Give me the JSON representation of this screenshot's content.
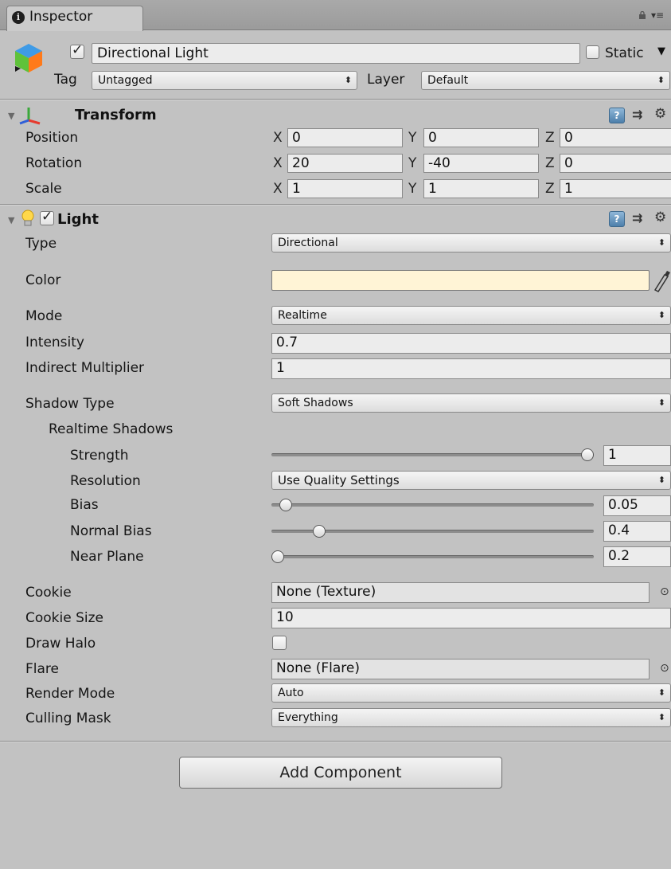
{
  "window": {
    "tab_title": "Inspector"
  },
  "header": {
    "object_name": "Directional Light",
    "active": true,
    "static_label": "Static",
    "static_checked": false,
    "tag_label": "Tag",
    "tag_value": "Untagged",
    "layer_label": "Layer",
    "layer_value": "Default"
  },
  "transform": {
    "title": "Transform",
    "position": {
      "label": "Position",
      "x": "0",
      "y": "0",
      "z": "0"
    },
    "rotation": {
      "label": "Rotation",
      "x": "20",
      "y": "-40",
      "z": "0"
    },
    "scale": {
      "label": "Scale",
      "x": "1",
      "y": "1",
      "z": "1"
    },
    "axes": {
      "x": "X",
      "y": "Y",
      "z": "Z"
    }
  },
  "light": {
    "title": "Light",
    "enabled": true,
    "type": {
      "label": "Type",
      "value": "Directional"
    },
    "color": {
      "label": "Color",
      "value": "#fff4d6"
    },
    "mode": {
      "label": "Mode",
      "value": "Realtime"
    },
    "intensity": {
      "label": "Intensity",
      "value": "0.7"
    },
    "indirect_multiplier": {
      "label": "Indirect Multiplier",
      "value": "1"
    },
    "shadow_type": {
      "label": "Shadow Type",
      "value": "Soft Shadows"
    },
    "realtime_shadows": {
      "label": "Realtime Shadows"
    },
    "strength": {
      "label": "Strength",
      "value": "1",
      "slider_fraction": 1.0
    },
    "resolution": {
      "label": "Resolution",
      "value": "Use Quality Settings"
    },
    "bias": {
      "label": "Bias",
      "value": "0.05",
      "slider_fraction": 0.025
    },
    "normal_bias": {
      "label": "Normal Bias",
      "value": "0.4",
      "slider_fraction": 0.133
    },
    "near_plane": {
      "label": "Near Plane",
      "value": "0.2",
      "slider_fraction": 0.0
    },
    "cookie": {
      "label": "Cookie",
      "value": "None (Texture)"
    },
    "cookie_size": {
      "label": "Cookie Size",
      "value": "10"
    },
    "draw_halo": {
      "label": "Draw Halo",
      "checked": false
    },
    "flare": {
      "label": "Flare",
      "value": "None (Flare)"
    },
    "render_mode": {
      "label": "Render Mode",
      "value": "Auto"
    },
    "culling_mask": {
      "label": "Culling Mask",
      "value": "Everything"
    }
  },
  "add_component_label": "Add Component",
  "icons": {
    "info": "info-icon",
    "lock": "lock-icon",
    "menu": "tab-menu-icon",
    "object": "gameobject-cube-icon",
    "transform": "transform-axes-icon",
    "light": "light-bulb-icon",
    "help": "help-icon",
    "preset": "preset-icon",
    "settings": "gear-icon",
    "eyedropper": "eyedropper-icon",
    "object_picker": "object-picker-icon"
  },
  "colors": {
    "background": "#c2c2c2",
    "field": "#ececec",
    "help_blue": "#5b8ab5"
  }
}
